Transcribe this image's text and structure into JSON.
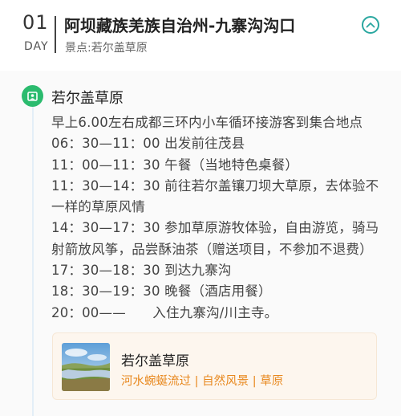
{
  "header": {
    "day_number": "01",
    "day_label": "DAY",
    "route_title": "阿坝藏族羌族自治州-九寨沟沟口",
    "spot_line": "景点:若尔盖草原",
    "collapse_icon": "chevron-up-icon",
    "accent_color": "#2aa7a0"
  },
  "spot": {
    "icon": "location-pin-icon",
    "icon_color": "#2bbb6e",
    "name": "若尔盖草原"
  },
  "itinerary": [
    "早上6.00左右成都三环内小车循环接游客到集合地点",
    "06：30—11：00 出发前往茂县",
    "11：00—11：30 午餐（当地特色桌餐）",
    "11：30—14：30 前往若尔盖镶刀坝大草原，去体验不",
    "一样的草原风情",
    "14：30—17：30 参加草原游牧体验，自由游览，骑马",
    "射箭放风筝，品尝酥油茶（赠送项目，不参加不退费）",
    "17：30—18：30 到达九寨沟",
    "18：30—19：30 晚餐（酒店用餐）",
    "20：00——　　入住九寨沟/川主寺。"
  ],
  "card": {
    "image": "grassland-river-photo",
    "title": "若尔盖草原",
    "tags": "河水蜿蜒流过 | 自然风景 | 草原",
    "tag_color": "#e8881e"
  }
}
